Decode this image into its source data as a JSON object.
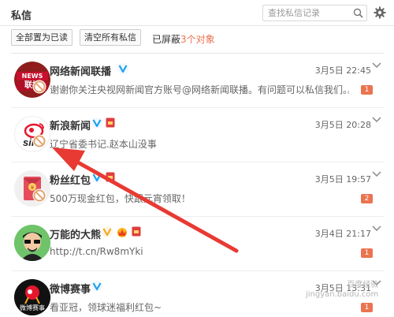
{
  "header": {
    "title": "私信",
    "search_placeholder": "查找私信记录"
  },
  "actions": {
    "mark_read": "全部置为已读",
    "clear_all": "清空所有私信",
    "blocked_prefix": "已屏蔽",
    "blocked_count": "3个对象"
  },
  "conversations": [
    {
      "name": "网络新闻联播",
      "preview": "谢谢你关注央视网新闻官方账号@网络新闻联播。有问题可以私信我们。。",
      "time": "3月5日 22:45",
      "unread": "1"
    },
    {
      "name": "新浪新闻",
      "preview": "辽宁省委书记.赵本山没事",
      "time": "3月5日 20:28",
      "unread": ""
    },
    {
      "name": "粉丝红包",
      "preview": "500万现金红包，快跟元宵领取！",
      "time": "3月5日 19:57",
      "unread": "2"
    },
    {
      "name": "万能的大熊",
      "preview": "http://t.cn/Rw8mYki",
      "time": "3月4日 21:17",
      "unread": "1"
    },
    {
      "name": "微博赛事",
      "preview": "看亚冠，领球迷福利红包~",
      "time": "3月5日 13:31",
      "unread": "1"
    }
  ],
  "avatars": {
    "news_text_1": "NEWS",
    "news_text_2": "联播",
    "sina_text": "sina",
    "sports_text": "微博赛事"
  },
  "watermark": {
    "line1": "百度经验",
    "line2": "jingyan.baidu.com"
  },
  "colors": {
    "accent": "#eb7350",
    "verified": "#1da1f2",
    "arrow": "#e83a33"
  }
}
